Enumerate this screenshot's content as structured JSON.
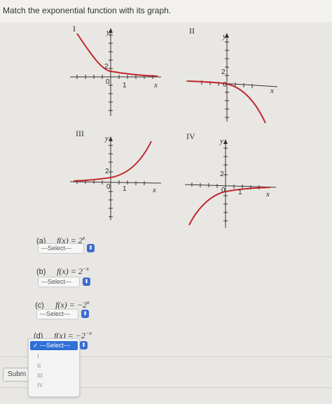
{
  "question": {
    "prompt": "Match the exponential function with its graph."
  },
  "graphs": [
    {
      "numeral": "I",
      "axis_label_y": "y",
      "axis_label_x": "x",
      "tick_y": "2",
      "tick_origin": "0",
      "tick_x": "1"
    },
    {
      "numeral": "II",
      "axis_label_y": "y",
      "axis_label_x": "x",
      "tick_y": "2",
      "tick_origin": "0",
      "tick_x": ""
    },
    {
      "numeral": "III",
      "axis_label_y": "y",
      "axis_label_x": "x",
      "tick_y": "2",
      "tick_origin": "0",
      "tick_x": "1"
    },
    {
      "numeral": "IV",
      "axis_label_y": "y",
      "axis_label_x": "x",
      "tick_y": "2",
      "tick_origin": "0",
      "tick_x": "1"
    }
  ],
  "parts": [
    {
      "label": "(a)",
      "fx": "f(x) = 2",
      "exp": "x",
      "select": "---Select---"
    },
    {
      "label": "(b)",
      "fx": "f(x) = 2",
      "exp": "−x",
      "select": "---Select---"
    },
    {
      "label": "(c)",
      "fx": "f(x) = −2",
      "exp": "x",
      "select": "---Select---"
    },
    {
      "label": "(d)",
      "fx": "f(x) = −2",
      "exp": "−x",
      "select": "---Select---"
    }
  ],
  "dropdown": {
    "selected": "✓ ---Select---",
    "options": [
      "I",
      "II",
      "III",
      "IV"
    ]
  },
  "submit": {
    "label": "Subm"
  },
  "colors": {
    "curve": "#c0272d",
    "accent": "#2f6fd6"
  }
}
